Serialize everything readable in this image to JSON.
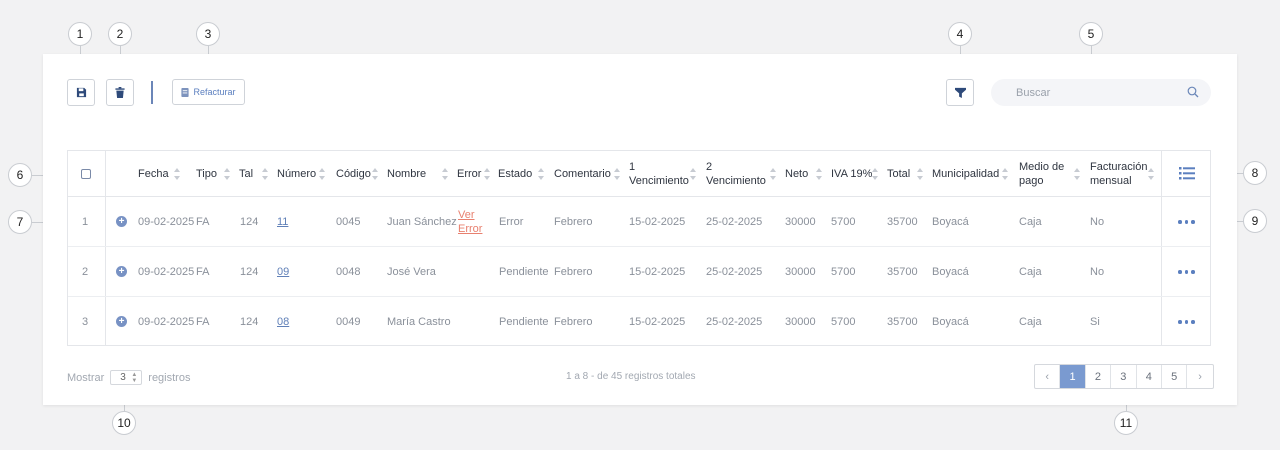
{
  "callouts": [
    "1",
    "2",
    "3",
    "4",
    "5",
    "6",
    "7",
    "8",
    "9",
    "10",
    "11"
  ],
  "toolbar": {
    "refacturar_label": "Refacturar",
    "search_placeholder": "Buscar"
  },
  "table": {
    "columns": [
      "Fecha",
      "Tipo",
      "Tal",
      "Número",
      "Código",
      "Nombre",
      "Error",
      "Estado",
      "Comentario",
      "1 Vencimiento",
      "2 Vencimiento",
      "Neto",
      "IVA 19%",
      "Total",
      "Municipalidad",
      "Medio de pago",
      "Facturación mensual"
    ],
    "rows": [
      {
        "index": "1",
        "fecha": "09-02-2025",
        "tipo": "FA",
        "tal": "124",
        "numero": "11",
        "codigo": "0045",
        "nombre": "Juan Sánchez",
        "error": "Ver Error",
        "estado": "Error",
        "comentario": "Febrero",
        "venc1": "15-02-2025",
        "venc2": "25-02-2025",
        "neto": "30000",
        "iva": "5700",
        "total": "35700",
        "municipalidad": "Boyacá",
        "medio": "Caja",
        "mensual": "No"
      },
      {
        "index": "2",
        "fecha": "09-02-2025",
        "tipo": "FA",
        "tal": "124",
        "numero": "09",
        "codigo": "0048",
        "nombre": "José Vera",
        "error": "",
        "estado": "Pendiente",
        "comentario": "Febrero",
        "venc1": "15-02-2025",
        "venc2": "25-02-2025",
        "neto": "30000",
        "iva": "5700",
        "total": "35700",
        "municipalidad": "Boyacá",
        "medio": "Caja",
        "mensual": "No"
      },
      {
        "index": "3",
        "fecha": "09-02-2025",
        "tipo": "FA",
        "tal": "124",
        "numero": "08",
        "codigo": "0049",
        "nombre": "María Castro",
        "error": "",
        "estado": "Pendiente",
        "comentario": "Febrero",
        "venc1": "15-02-2025",
        "venc2": "25-02-2025",
        "neto": "30000",
        "iva": "5700",
        "total": "35700",
        "municipalidad": "Boyacá",
        "medio": "Caja",
        "mensual": "Si"
      }
    ]
  },
  "footer": {
    "show_label": "Mostrar",
    "per_page": "3",
    "records_label": "registros",
    "total_text": "1 a 8 - de 45 registros totales",
    "pages": [
      "1",
      "2",
      "3",
      "4",
      "5"
    ],
    "active_page": "1"
  },
  "colors": {
    "accent": "#7a9ad0",
    "primary_icon": "#2e4a7a",
    "error": "#e8806f"
  }
}
